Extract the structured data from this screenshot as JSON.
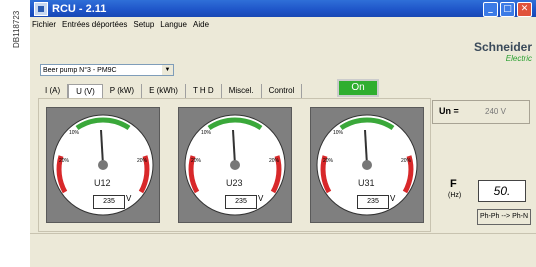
{
  "side_code": "DB118723",
  "window": {
    "title": "RCU - 2.11",
    "controls": [
      "minimize-icon",
      "maximize-icon",
      "close-icon"
    ]
  },
  "menu": [
    "Fichier",
    "Entrées déportées",
    "Setup",
    "Langue",
    "Aide"
  ],
  "brand": {
    "line1": "Schneider",
    "line2": "Electric"
  },
  "device_select": {
    "value": "Beer pump N°3 - PM9C"
  },
  "tabs": [
    {
      "label": "I (A)"
    },
    {
      "label": "U (V)",
      "active": true
    },
    {
      "label": "P (kW)"
    },
    {
      "label": "E (kWh)"
    },
    {
      "label": "T H D"
    },
    {
      "label": "Miscel."
    },
    {
      "label": "Control"
    }
  ],
  "status_button": {
    "label": "On",
    "color": "#2fae2f"
  },
  "gauges": [
    {
      "name": "U12",
      "value": "235",
      "unit": "V",
      "scale_labels": [
        "10%",
        "20%",
        "20%"
      ]
    },
    {
      "name": "U23",
      "value": "235",
      "unit": "V",
      "scale_labels": [
        "10%",
        "20%",
        "20%"
      ]
    },
    {
      "name": "U31",
      "value": "235",
      "unit": "V",
      "scale_labels": [
        "10%",
        "20%",
        "20%"
      ]
    }
  ],
  "un": {
    "label": "Un =",
    "value": "240",
    "unit": "V"
  },
  "frequency": {
    "label": "F",
    "unit": "(Hz)",
    "value": "50."
  },
  "phase_button": {
    "label": "Ph-Ph --> Ph-N"
  },
  "colors": {
    "titlebar": "#1e54c8",
    "on_green": "#2fae2f",
    "arc_red": "#d8282a",
    "arc_green": "#3aa83a"
  }
}
